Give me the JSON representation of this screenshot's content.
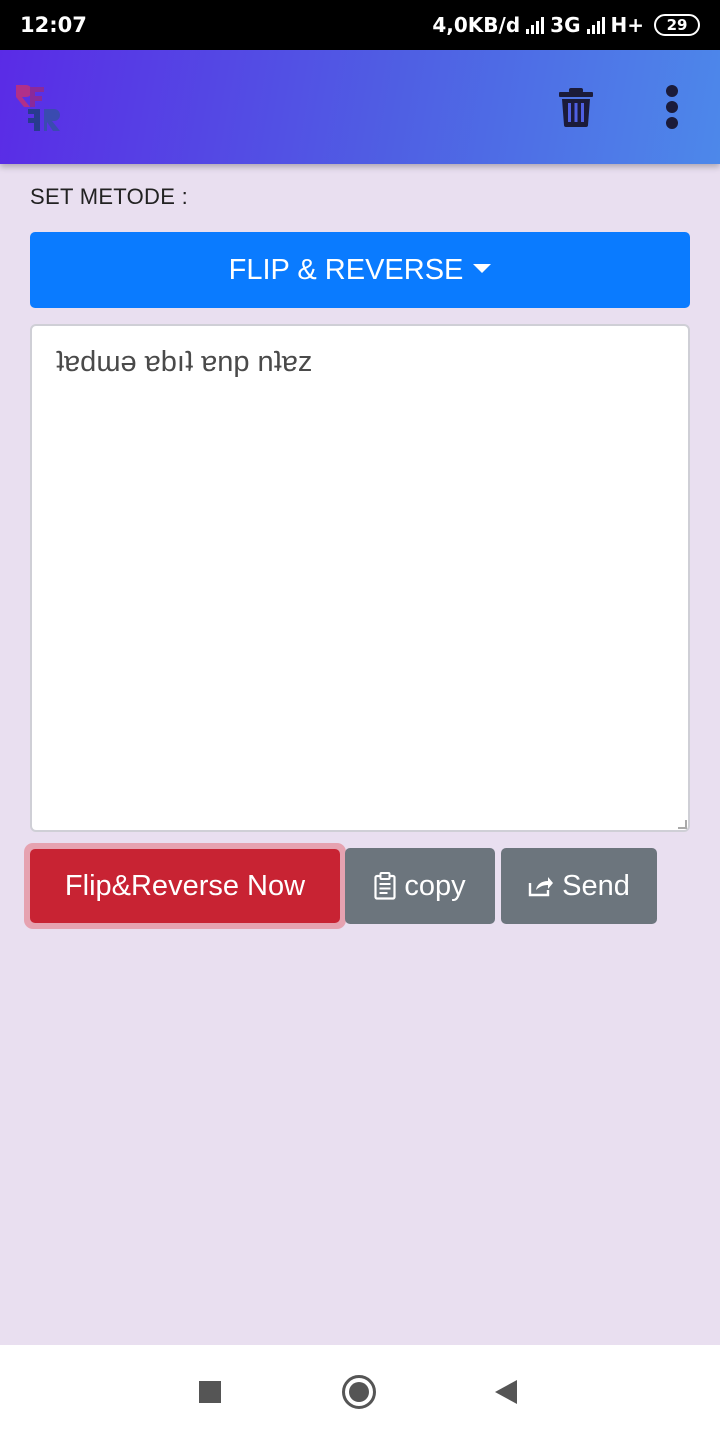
{
  "status_bar": {
    "time": "12:07",
    "speed": "4,0KB/d",
    "network_1": "3G",
    "network_2": "H+",
    "battery": "29"
  },
  "app_bar": {
    "logo_icon": "flip-reverse-logo",
    "trash_icon": "trash-icon",
    "more_icon": "more-vert-icon"
  },
  "method": {
    "label": "SET METODE :",
    "selected": "FLIP & REVERSE"
  },
  "editor": {
    "text": "ʇɐdɯə ɐbıʇ ɐnp nʇɐz"
  },
  "buttons": {
    "flip": "Flip&Reverse Now",
    "copy": "copy",
    "send": "Send"
  },
  "colors": {
    "primary": "#0a7bff",
    "danger": "#c82333",
    "secondary": "#6c757d",
    "background": "#e9dff0"
  }
}
